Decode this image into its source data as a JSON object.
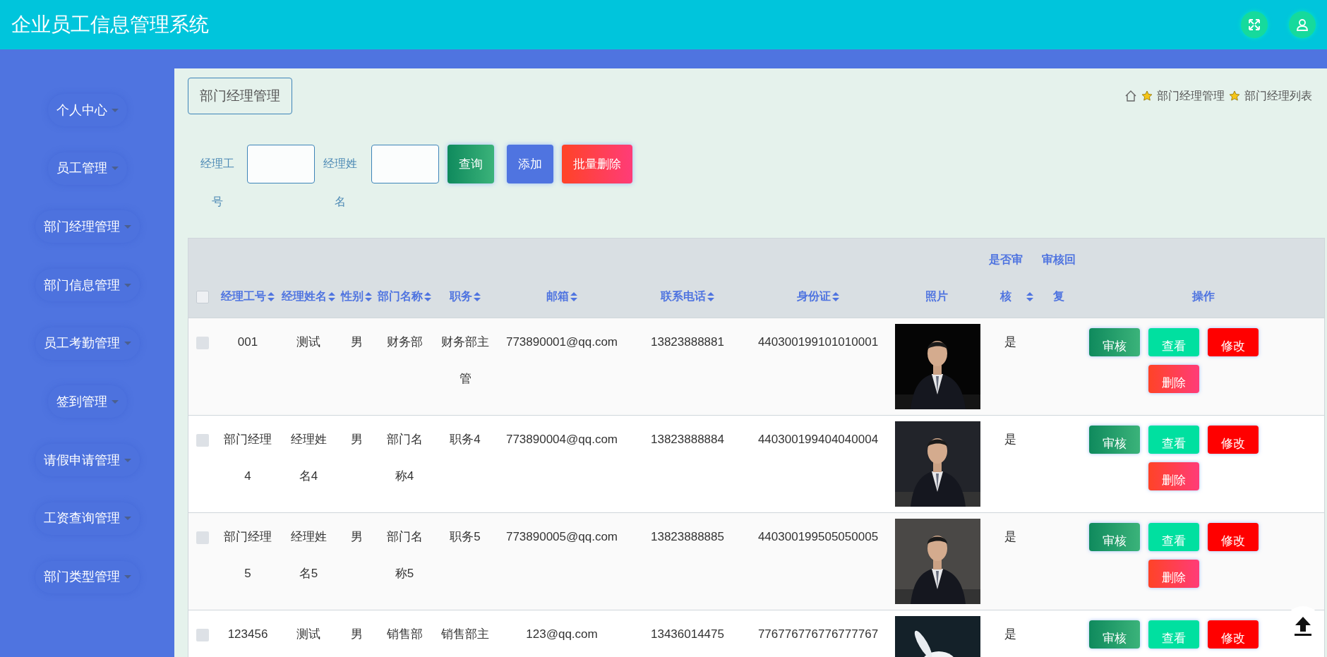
{
  "app_title": "企业员工信息管理系统",
  "header_actions": [
    {
      "kind": "fullscreen"
    },
    {
      "kind": "user"
    }
  ],
  "sidebar": {
    "items": [
      {
        "label": "个人中心"
      },
      {
        "label": "员工管理"
      },
      {
        "label": "部门经理管理"
      },
      {
        "label": "部门信息管理"
      },
      {
        "label": "员工考勤管理"
      },
      {
        "label": "签到管理"
      },
      {
        "label": "请假申请管理"
      },
      {
        "label": "工资查询管理"
      },
      {
        "label": "部门类型管理"
      }
    ]
  },
  "page_title": "部门经理管理",
  "breadcrumb": [
    "部门经理管理",
    "部门经理列表"
  ],
  "search": {
    "fields": [
      {
        "label": "经理工号"
      },
      {
        "label": "经理姓名"
      }
    ],
    "buttons": [
      {
        "label": "查询",
        "kind": "search"
      },
      {
        "label": "添加",
        "kind": "add"
      },
      {
        "label": "批量删除",
        "kind": "bulk-delete"
      }
    ]
  },
  "table": {
    "select_all": {
      "checked": false
    },
    "columns": [
      {
        "label": "经理工号",
        "sortable": true
      },
      {
        "label": "经理姓名",
        "sortable": true
      },
      {
        "label": "性别",
        "sortable": true
      },
      {
        "label": "部门名称",
        "sortable": true
      },
      {
        "label": "职务",
        "sortable": true
      },
      {
        "label": "邮箱",
        "sortable": true
      },
      {
        "label": "联系电话",
        "sortable": true
      },
      {
        "label": "身份证",
        "sortable": true
      },
      {
        "label": "照片",
        "sortable": false
      },
      {
        "label": "是否审核",
        "sortable": true
      },
      {
        "label": "审核回复",
        "sortable": false
      },
      {
        "label": "操作",
        "sortable": false
      }
    ],
    "rows": [
      {
        "checked": false,
        "cells": [
          "001",
          "测试",
          "男",
          "财务部",
          "财务部主管",
          "773890001@qq.com",
          "13823888881",
          "440300199101010001"
        ],
        "photo": {
          "kind": "picture"
        },
        "audit": "是",
        "actions": [
          {
            "label": "审核",
            "kind": "audit"
          },
          {
            "label": "查看",
            "kind": "view"
          },
          {
            "label": "修改",
            "kind": "edit"
          },
          {
            "label": "删除",
            "kind": "delete"
          }
        ]
      },
      {
        "checked": false,
        "cells": [
          "部门经理4",
          "经理姓名4",
          "男",
          "部门名称4",
          "职务4",
          "773890004@qq.com",
          "13823888884",
          "440300199404040004"
        ],
        "photo": {
          "kind": "picture"
        },
        "audit": "是",
        "actions": [
          {
            "label": "审核",
            "kind": "audit"
          },
          {
            "label": "查看",
            "kind": "view"
          },
          {
            "label": "修改",
            "kind": "edit"
          },
          {
            "label": "删除",
            "kind": "delete"
          }
        ]
      },
      {
        "checked": false,
        "cells": [
          "部门经理5",
          "经理姓名5",
          "男",
          "部门名称5",
          "职务5",
          "773890005@qq.com",
          "13823888885",
          "440300199505050005"
        ],
        "photo": {
          "kind": "picture"
        },
        "audit": "是",
        "actions": [
          {
            "label": "审核",
            "kind": "audit"
          },
          {
            "label": "查看",
            "kind": "view"
          },
          {
            "label": "修改",
            "kind": "edit"
          },
          {
            "label": "删除",
            "kind": "delete"
          }
        ]
      },
      {
        "checked": false,
        "cells": [
          "123456",
          "测试",
          "男",
          "销售部",
          "销售部主",
          "123@qq.com",
          "13436014475",
          "776776776776777767"
        ],
        "photo": {
          "kind": "picture"
        },
        "audit": "是",
        "actions": [
          {
            "label": "审核",
            "kind": "audit"
          },
          {
            "label": "查看",
            "kind": "view"
          },
          {
            "label": "修改",
            "kind": "edit"
          }
        ]
      }
    ]
  }
}
